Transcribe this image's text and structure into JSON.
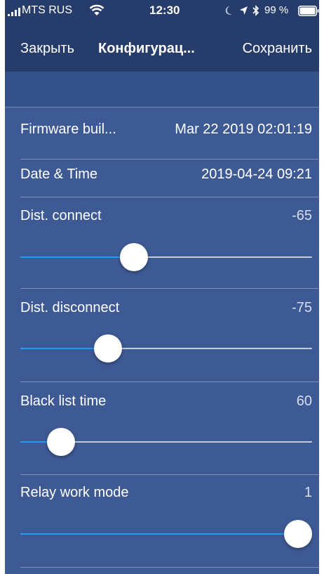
{
  "status_bar": {
    "carrier": "MTS RUS",
    "time": "12:30",
    "battery_percent": "99 %"
  },
  "nav": {
    "close_label": "Закрыть",
    "title": "Конфигурац...",
    "save_label": "Сохранить"
  },
  "info_rows": [
    {
      "label": "Firmware buil...",
      "value": "Mar 22 2019 02:01:19"
    },
    {
      "label": "Date & Time",
      "value": "2019-04-24 09:21"
    }
  ],
  "slider_rows": [
    {
      "label": "Dist. connect",
      "value": "-65",
      "position": 0.39
    },
    {
      "label": "Dist. disconnect",
      "value": "-75",
      "position": 0.3
    },
    {
      "label": "Black list time",
      "value": "60",
      "position": 0.14
    },
    {
      "label": "Relay work mode",
      "value": "1",
      "position": 1.0
    }
  ],
  "colors": {
    "background": "#3e5a94",
    "nav_bar": "#263d6b",
    "slider_fill": "#1e9bf0",
    "slider_track": "#c7cdd8",
    "separator": "#7b90bb"
  },
  "icons": {
    "signal": "signal-icon",
    "wifi": "wifi-icon",
    "moon": "moon-icon",
    "location": "location-icon",
    "bluetooth": "bluetooth-icon",
    "battery": "battery-icon"
  }
}
